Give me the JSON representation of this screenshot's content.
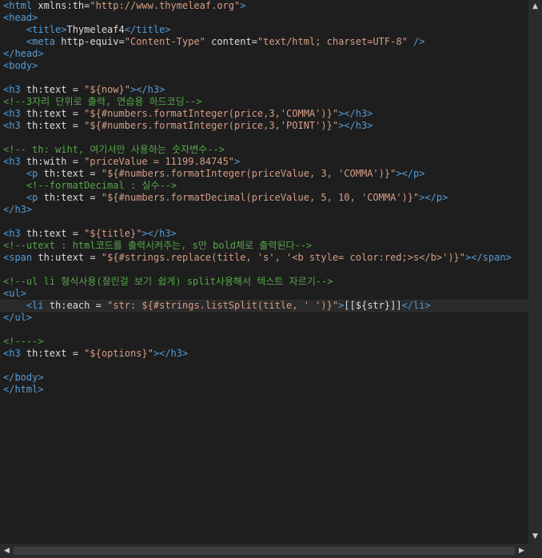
{
  "editor": {
    "lines": [
      [
        [
          "tag",
          "<html "
        ],
        [
          "attr",
          "xmlns:th"
        ],
        [
          "txt",
          "="
        ],
        [
          "str",
          "\"http://www.thymeleaf.org\""
        ],
        [
          "tag",
          ">"
        ]
      ],
      [
        [
          "tag",
          "<head>"
        ]
      ],
      [
        [
          "txt",
          "    "
        ],
        [
          "tag",
          "<title>"
        ],
        [
          "txt",
          "Thymeleaf4"
        ],
        [
          "tag",
          "</title>"
        ]
      ],
      [
        [
          "txt",
          "    "
        ],
        [
          "tag",
          "<meta "
        ],
        [
          "attr",
          "http-equiv"
        ],
        [
          "txt",
          "="
        ],
        [
          "str",
          "\"Content-Type\""
        ],
        [
          "txt",
          " "
        ],
        [
          "attr",
          "content"
        ],
        [
          "txt",
          "="
        ],
        [
          "str",
          "\"text/html; charset=UTF-8\""
        ],
        [
          "txt",
          " "
        ],
        [
          "tag",
          "/>"
        ]
      ],
      [
        [
          "tag",
          "</head>"
        ]
      ],
      [
        [
          "tag",
          "<body>"
        ]
      ],
      [],
      [
        [
          "tag",
          "<h3 "
        ],
        [
          "attr",
          "th:text"
        ],
        [
          "txt",
          " = "
        ],
        [
          "str",
          "\"${now}\""
        ],
        [
          "tag",
          "></h3>"
        ]
      ],
      [
        [
          "cmt",
          "<!--3자리 단위로 출력, 연습용 하드코딩-->"
        ]
      ],
      [
        [
          "tag",
          "<h3 "
        ],
        [
          "attr",
          "th:text"
        ],
        [
          "txt",
          " = "
        ],
        [
          "str",
          "\"${#numbers.formatInteger(price,3,'COMMA')}\""
        ],
        [
          "tag",
          "></h3>"
        ]
      ],
      [
        [
          "tag",
          "<h3 "
        ],
        [
          "attr",
          "th:text"
        ],
        [
          "txt",
          " = "
        ],
        [
          "str",
          "\"${#numbers.formatInteger(price,3,'POINT')}\""
        ],
        [
          "tag",
          "></h3>"
        ]
      ],
      [],
      [
        [
          "cmt",
          "<!-- th: wiht, 여기서만 사용하는 숫자변수-->"
        ]
      ],
      [
        [
          "tag",
          "<h3 "
        ],
        [
          "attr",
          "th:with"
        ],
        [
          "txt",
          " = "
        ],
        [
          "str",
          "\"priceValue = 11199.84745\""
        ],
        [
          "tag",
          ">"
        ]
      ],
      [
        [
          "txt",
          "    "
        ],
        [
          "tag",
          "<p "
        ],
        [
          "attr",
          "th:text"
        ],
        [
          "txt",
          " = "
        ],
        [
          "str",
          "\"${#numbers.formatInteger(priceValue, 3, 'COMMA')}\""
        ],
        [
          "tag",
          "></p>"
        ]
      ],
      [
        [
          "txt",
          "    "
        ],
        [
          "cmt",
          "<!--formatDecimal : 실수-->"
        ]
      ],
      [
        [
          "txt",
          "    "
        ],
        [
          "tag",
          "<p "
        ],
        [
          "attr",
          "th:text"
        ],
        [
          "txt",
          " = "
        ],
        [
          "str",
          "\"${#numbers.formatDecimal(priceValue, 5, 10, 'COMMA')}\""
        ],
        [
          "tag",
          "></p>"
        ]
      ],
      [
        [
          "tag",
          "</h3>"
        ]
      ],
      [],
      [
        [
          "tag",
          "<h3 "
        ],
        [
          "attr",
          "th:text"
        ],
        [
          "txt",
          " = "
        ],
        [
          "str",
          "\"${title}\""
        ],
        [
          "tag",
          "></h3>"
        ]
      ],
      [
        [
          "cmt",
          "<!--utext : html코드를 출력시켜주는, s만 bold체로 출력된다-->"
        ]
      ],
      [
        [
          "tag",
          "<span "
        ],
        [
          "attr",
          "th:utext"
        ],
        [
          "txt",
          " = "
        ],
        [
          "str",
          "\"${#strings.replace(title, 's', '<b style= color:red;>s</b>')}\""
        ],
        [
          "tag",
          "></span>"
        ]
      ],
      [],
      [
        [
          "cmt",
          "<!--ul li 형식사용(잘린걸 보기 쉽게) split사용해서 텍스트 자르기-->"
        ]
      ],
      [
        [
          "tag",
          "<ul>"
        ]
      ],
      [
        [
          "txt",
          "    "
        ],
        [
          "tag",
          "<li "
        ],
        [
          "attr",
          "th:each"
        ],
        [
          "txt",
          " = "
        ],
        [
          "str",
          "\"str: ${#strings.listSplit(title, ' ')}\""
        ],
        [
          "tag",
          ">"
        ],
        [
          "txt",
          "[[${str}]]"
        ],
        [
          "tag",
          "</li>"
        ]
      ],
      [
        [
          "tag",
          "</ul>"
        ]
      ],
      [],
      [
        [
          "cmt",
          "<!---->"
        ]
      ],
      [
        [
          "tag",
          "<h3 "
        ],
        [
          "attr",
          "th:text"
        ],
        [
          "txt",
          " = "
        ],
        [
          "str",
          "\"${options}\""
        ],
        [
          "tag",
          "></h3>"
        ]
      ],
      [],
      [
        [
          "tag",
          "</body>"
        ]
      ],
      [
        [
          "tag",
          "</html>"
        ]
      ]
    ],
    "current_line_index": 25
  },
  "scrollbars": {
    "up_arrow": "▲",
    "down_arrow": "▼",
    "left_arrow": "◀",
    "right_arrow": "▶"
  },
  "colors": {
    "background": "#1e1e1e",
    "tag": "#569cd6",
    "attribute": "#dcdcdc",
    "string": "#d69d85",
    "comment": "#57a64a",
    "text": "#dcdcdc"
  }
}
